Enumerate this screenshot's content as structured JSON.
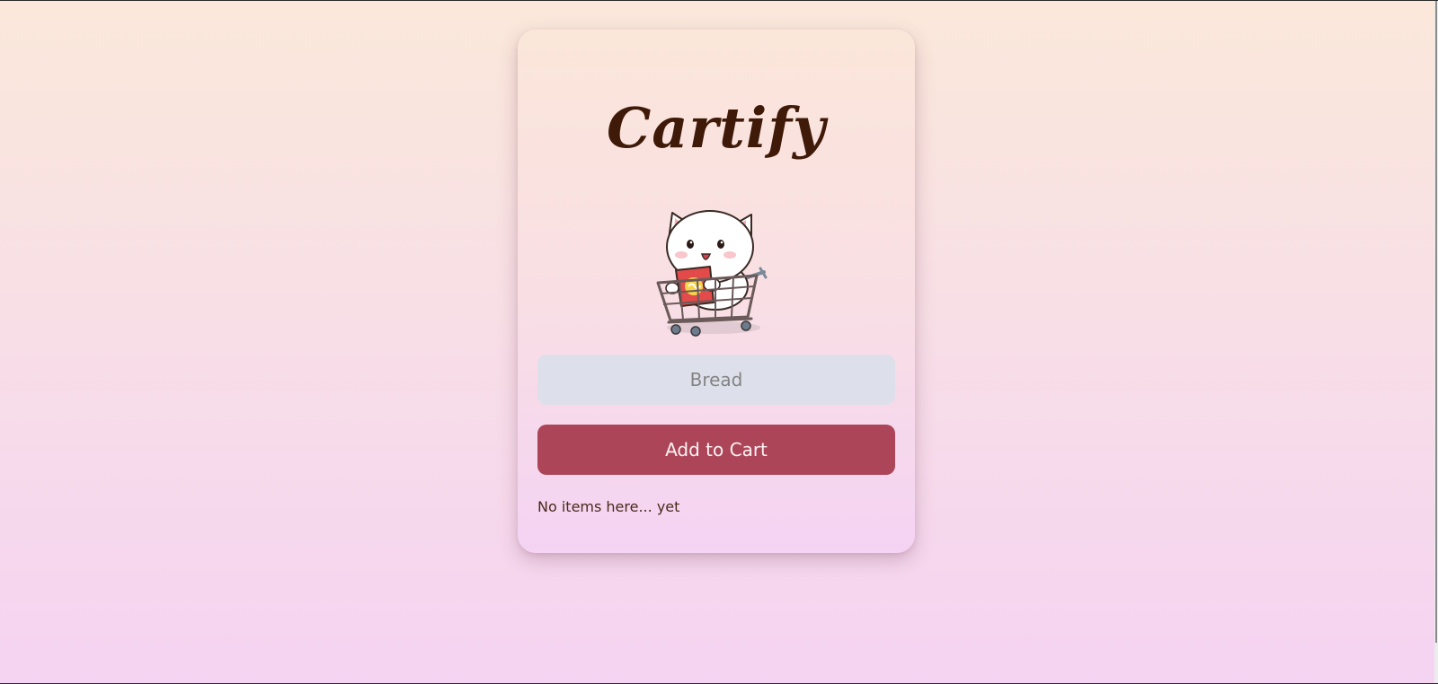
{
  "app": {
    "title": "Cartify"
  },
  "form": {
    "item_placeholder": "Bread",
    "item_value": "",
    "add_button_label": "Add to Cart"
  },
  "cart": {
    "empty_message": "No items here... yet"
  },
  "icons": {
    "mascot": "cat-in-shopping-cart-icon"
  },
  "colors": {
    "accent": "#ad4559",
    "title": "#3f1a08",
    "input_background": "#dde0ea"
  }
}
